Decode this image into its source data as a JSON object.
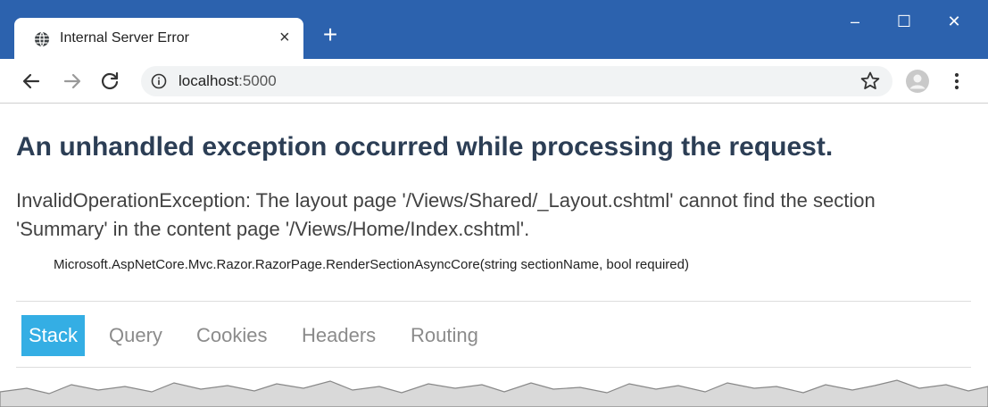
{
  "browser": {
    "tab": {
      "title": "Internal Server Error",
      "close_glyph": "×"
    },
    "new_tab_glyph": "+",
    "window_controls": {
      "minimize": "–",
      "maximize": "☐",
      "close": "✕"
    },
    "address": {
      "host": "localhost",
      "port": ":5000"
    }
  },
  "page": {
    "headline": "An unhandled exception occurred while processing the request.",
    "message": "InvalidOperationException: The layout page '/Views/Shared/_Layout.cshtml' cannot find the section 'Summary' in the content page '/Views/Home/Index.cshtml'.",
    "location": "Microsoft.AspNetCore.Mvc.Razor.RazorPage.RenderSectionAsyncCore(string sectionName, bool required)",
    "tabs": [
      {
        "label": "Stack",
        "active": true
      },
      {
        "label": "Query",
        "active": false
      },
      {
        "label": "Cookies",
        "active": false
      },
      {
        "label": "Headers",
        "active": false
      },
      {
        "label": "Routing",
        "active": false
      }
    ]
  },
  "colors": {
    "titlebar": "#2c62ae",
    "headline": "#2c3e55",
    "active_tab": "#34aee4"
  }
}
